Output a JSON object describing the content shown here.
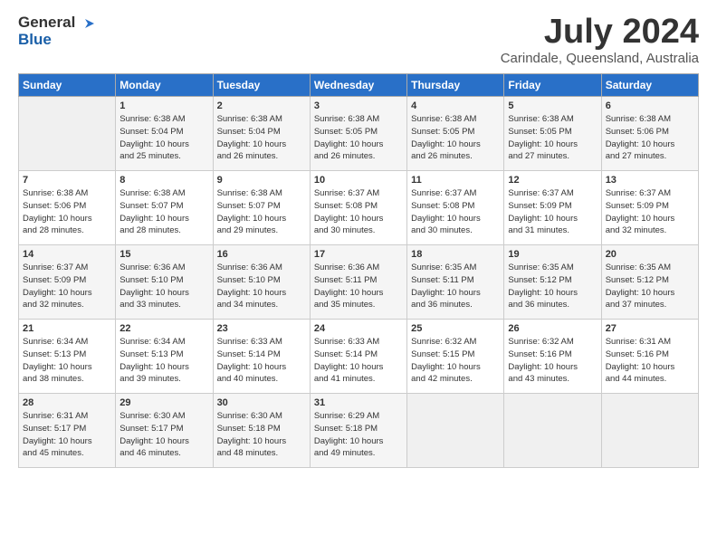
{
  "header": {
    "logo_line1": "General",
    "logo_line2": "Blue",
    "title": "July 2024",
    "subtitle": "Carindale, Queensland, Australia"
  },
  "days_of_week": [
    "Sunday",
    "Monday",
    "Tuesday",
    "Wednesday",
    "Thursday",
    "Friday",
    "Saturday"
  ],
  "weeks": [
    [
      {
        "day": "",
        "info": ""
      },
      {
        "day": "1",
        "info": "Sunrise: 6:38 AM\nSunset: 5:04 PM\nDaylight: 10 hours\nand 25 minutes."
      },
      {
        "day": "2",
        "info": "Sunrise: 6:38 AM\nSunset: 5:04 PM\nDaylight: 10 hours\nand 26 minutes."
      },
      {
        "day": "3",
        "info": "Sunrise: 6:38 AM\nSunset: 5:05 PM\nDaylight: 10 hours\nand 26 minutes."
      },
      {
        "day": "4",
        "info": "Sunrise: 6:38 AM\nSunset: 5:05 PM\nDaylight: 10 hours\nand 26 minutes."
      },
      {
        "day": "5",
        "info": "Sunrise: 6:38 AM\nSunset: 5:05 PM\nDaylight: 10 hours\nand 27 minutes."
      },
      {
        "day": "6",
        "info": "Sunrise: 6:38 AM\nSunset: 5:06 PM\nDaylight: 10 hours\nand 27 minutes."
      }
    ],
    [
      {
        "day": "7",
        "info": "Sunrise: 6:38 AM\nSunset: 5:06 PM\nDaylight: 10 hours\nand 28 minutes."
      },
      {
        "day": "8",
        "info": "Sunrise: 6:38 AM\nSunset: 5:07 PM\nDaylight: 10 hours\nand 28 minutes."
      },
      {
        "day": "9",
        "info": "Sunrise: 6:38 AM\nSunset: 5:07 PM\nDaylight: 10 hours\nand 29 minutes."
      },
      {
        "day": "10",
        "info": "Sunrise: 6:37 AM\nSunset: 5:08 PM\nDaylight: 10 hours\nand 30 minutes."
      },
      {
        "day": "11",
        "info": "Sunrise: 6:37 AM\nSunset: 5:08 PM\nDaylight: 10 hours\nand 30 minutes."
      },
      {
        "day": "12",
        "info": "Sunrise: 6:37 AM\nSunset: 5:09 PM\nDaylight: 10 hours\nand 31 minutes."
      },
      {
        "day": "13",
        "info": "Sunrise: 6:37 AM\nSunset: 5:09 PM\nDaylight: 10 hours\nand 32 minutes."
      }
    ],
    [
      {
        "day": "14",
        "info": "Sunrise: 6:37 AM\nSunset: 5:09 PM\nDaylight: 10 hours\nand 32 minutes."
      },
      {
        "day": "15",
        "info": "Sunrise: 6:36 AM\nSunset: 5:10 PM\nDaylight: 10 hours\nand 33 minutes."
      },
      {
        "day": "16",
        "info": "Sunrise: 6:36 AM\nSunset: 5:10 PM\nDaylight: 10 hours\nand 34 minutes."
      },
      {
        "day": "17",
        "info": "Sunrise: 6:36 AM\nSunset: 5:11 PM\nDaylight: 10 hours\nand 35 minutes."
      },
      {
        "day": "18",
        "info": "Sunrise: 6:35 AM\nSunset: 5:11 PM\nDaylight: 10 hours\nand 36 minutes."
      },
      {
        "day": "19",
        "info": "Sunrise: 6:35 AM\nSunset: 5:12 PM\nDaylight: 10 hours\nand 36 minutes."
      },
      {
        "day": "20",
        "info": "Sunrise: 6:35 AM\nSunset: 5:12 PM\nDaylight: 10 hours\nand 37 minutes."
      }
    ],
    [
      {
        "day": "21",
        "info": "Sunrise: 6:34 AM\nSunset: 5:13 PM\nDaylight: 10 hours\nand 38 minutes."
      },
      {
        "day": "22",
        "info": "Sunrise: 6:34 AM\nSunset: 5:13 PM\nDaylight: 10 hours\nand 39 minutes."
      },
      {
        "day": "23",
        "info": "Sunrise: 6:33 AM\nSunset: 5:14 PM\nDaylight: 10 hours\nand 40 minutes."
      },
      {
        "day": "24",
        "info": "Sunrise: 6:33 AM\nSunset: 5:14 PM\nDaylight: 10 hours\nand 41 minutes."
      },
      {
        "day": "25",
        "info": "Sunrise: 6:32 AM\nSunset: 5:15 PM\nDaylight: 10 hours\nand 42 minutes."
      },
      {
        "day": "26",
        "info": "Sunrise: 6:32 AM\nSunset: 5:16 PM\nDaylight: 10 hours\nand 43 minutes."
      },
      {
        "day": "27",
        "info": "Sunrise: 6:31 AM\nSunset: 5:16 PM\nDaylight: 10 hours\nand 44 minutes."
      }
    ],
    [
      {
        "day": "28",
        "info": "Sunrise: 6:31 AM\nSunset: 5:17 PM\nDaylight: 10 hours\nand 45 minutes."
      },
      {
        "day": "29",
        "info": "Sunrise: 6:30 AM\nSunset: 5:17 PM\nDaylight: 10 hours\nand 46 minutes."
      },
      {
        "day": "30",
        "info": "Sunrise: 6:30 AM\nSunset: 5:18 PM\nDaylight: 10 hours\nand 48 minutes."
      },
      {
        "day": "31",
        "info": "Sunrise: 6:29 AM\nSunset: 5:18 PM\nDaylight: 10 hours\nand 49 minutes."
      },
      {
        "day": "",
        "info": ""
      },
      {
        "day": "",
        "info": ""
      },
      {
        "day": "",
        "info": ""
      }
    ]
  ]
}
